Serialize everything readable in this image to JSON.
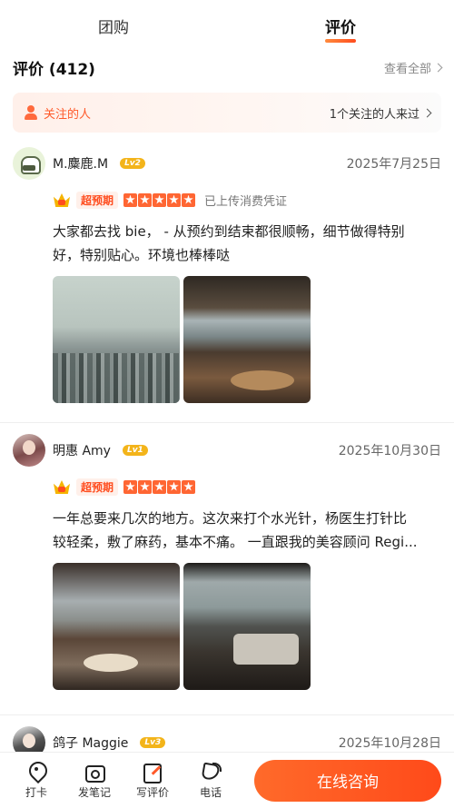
{
  "tabs": [
    {
      "label": "团购"
    },
    {
      "label": "评价"
    }
  ],
  "reviews_header": {
    "title": "评价 (412)",
    "see_all": "查看全部"
  },
  "follow_bar": {
    "left_label": "关注的人",
    "right_label": "1个关注的人来过"
  },
  "reviews": [
    {
      "user": "M.麋鹿.M",
      "level": "Lv2",
      "date": "2025年7月25日",
      "tag": "超预期",
      "stars": 5,
      "verified": "已上传消费凭证",
      "text_line1": "大家都去找 bie， - 从预约到结束都很顺畅，细节做得特别",
      "text_line2": "好，特别贴心。环境也棒棒哒"
    },
    {
      "user": "明惠 Amy",
      "level": "Lv1",
      "date": "2025年10月30日",
      "tag": "超预期",
      "stars": 5,
      "verified": "",
      "text_line1": "一年总要来几次的地方。这次来打个水光针，杨医生打针比",
      "text_line2": "较轻柔，敷了麻药，基本不痛。 一直跟我的美容顾问 Regi..."
    },
    {
      "user": "鸽子 Maggie",
      "level": "Lv3",
      "date": "2025年10月28日"
    }
  ],
  "bottom_bar": {
    "items": [
      {
        "label": "打卡",
        "icon": "location-pin-icon"
      },
      {
        "label": "发笔记",
        "icon": "camera-note-icon"
      },
      {
        "label": "写评价",
        "icon": "write-review-icon"
      },
      {
        "label": "电话",
        "icon": "phone-icon"
      }
    ],
    "consult_label": "在线咨询"
  },
  "colors": {
    "accent": "#ff5a2a",
    "level_badge": "#f3b41a"
  }
}
